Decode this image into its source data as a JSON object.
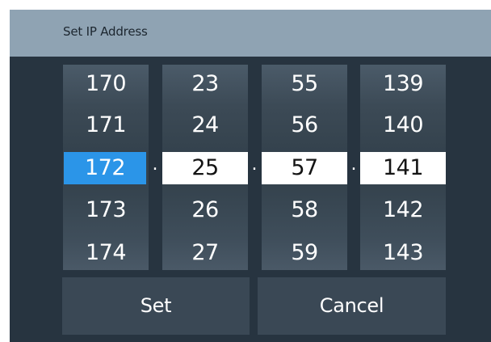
{
  "dialog": {
    "title": "Set IP Address"
  },
  "octets": [
    {
      "values": [
        "170",
        "171",
        "172",
        "173",
        "174"
      ],
      "selected": "172"
    },
    {
      "values": [
        "23",
        "24",
        "25",
        "26",
        "27"
      ],
      "selected": "25"
    },
    {
      "values": [
        "55",
        "56",
        "57",
        "58",
        "59"
      ],
      "selected": "57"
    },
    {
      "values": [
        "139",
        "140",
        "141",
        "142",
        "143"
      ],
      "selected": "141"
    }
  ],
  "separator": ".",
  "actions": {
    "set_label": "Set",
    "cancel_label": "Cancel"
  },
  "colors": {
    "titlebar": "#8fa3b3",
    "panel": "#273440",
    "focused_selection": "#2b95e8",
    "selection": "#ffffff"
  }
}
